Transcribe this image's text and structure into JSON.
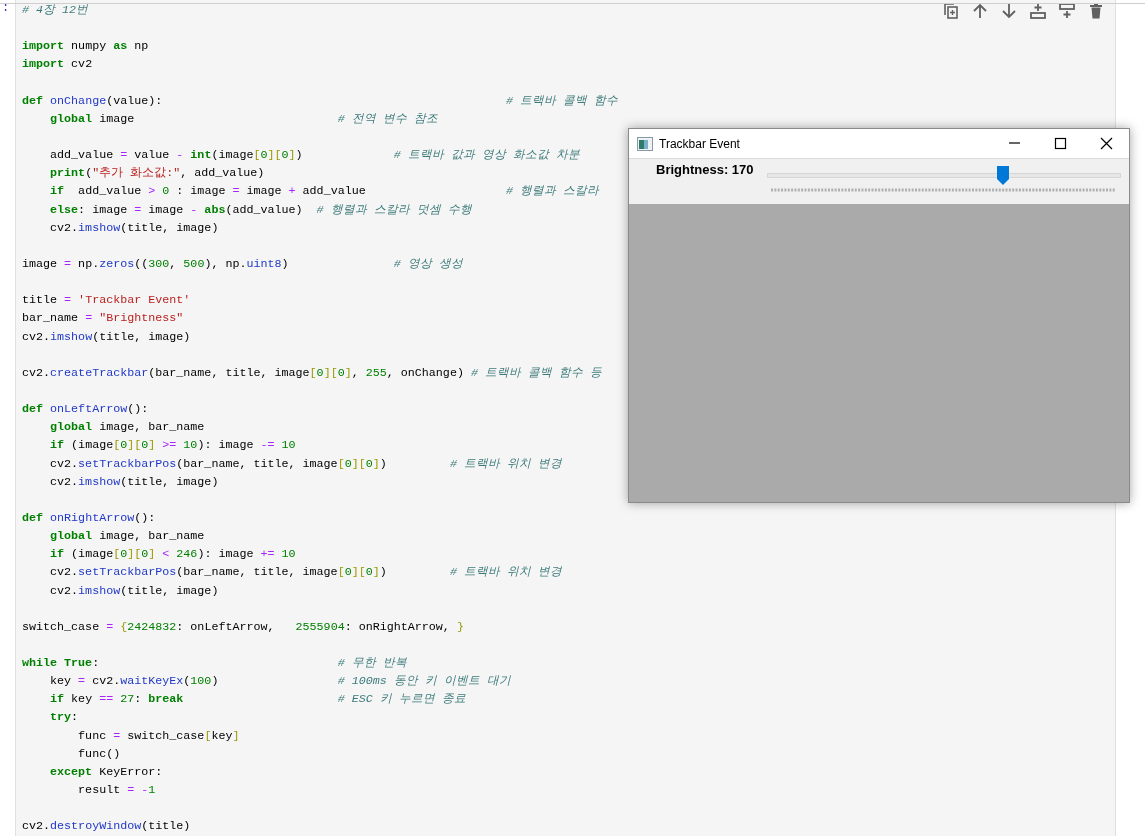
{
  "cell": {
    "prompt": ":",
    "blocks": [
      [
        [
          {
            "kind": "cm",
            "text": "# 4장 12번"
          }
        ]
      ],
      [
        [
          {
            "kind": "kw",
            "text": "import"
          },
          {
            "kind": "tx",
            "text": " numpy "
          },
          {
            "kind": "kw",
            "text": "as"
          },
          {
            "kind": "tx",
            "text": " np"
          }
        ],
        [
          {
            "kind": "kw",
            "text": "import"
          },
          {
            "kind": "tx",
            "text": " cv2"
          }
        ]
      ],
      [
        [
          {
            "kind": "kw",
            "text": "def "
          },
          {
            "kind": "call",
            "text": "onChange"
          },
          {
            "kind": "tx",
            "text": "(value):                                                 "
          },
          {
            "kind": "cm",
            "text": "# 트랙바 콜백 함수"
          }
        ],
        [
          {
            "kind": "kw",
            "text": "    global"
          },
          {
            "kind": "tx",
            "text": " image                             "
          },
          {
            "kind": "cm",
            "text": "# 전역 변수 참조"
          }
        ]
      ],
      [
        [
          {
            "kind": "tx",
            "text": "    add_value "
          },
          {
            "kind": "op",
            "text": "="
          },
          {
            "kind": "tx",
            "text": " value "
          },
          {
            "kind": "op",
            "text": "-"
          },
          {
            "kind": "kw",
            "text": " int"
          },
          {
            "kind": "tx",
            "text": "(image"
          },
          {
            "kind": "br",
            "text": "["
          },
          {
            "kind": "num",
            "text": "0"
          },
          {
            "kind": "br",
            "text": "]["
          },
          {
            "kind": "num",
            "text": "0"
          },
          {
            "kind": "br",
            "text": "]"
          },
          {
            "kind": "tx",
            "text": ")             "
          },
          {
            "kind": "cm",
            "text": "# 트랙바 값과 영상 화소값 차분"
          }
        ],
        [
          {
            "kind": "kw",
            "text": "    print"
          },
          {
            "kind": "tx",
            "text": "("
          },
          {
            "kind": "str",
            "text": "\"추가 화소값:\""
          },
          {
            "kind": "tx",
            "text": ", add_value)"
          }
        ],
        [
          {
            "kind": "kw",
            "text": "    if"
          },
          {
            "kind": "tx",
            "text": "  add_value "
          },
          {
            "kind": "op",
            "text": ">"
          },
          {
            "kind": "num",
            "text": " 0"
          },
          {
            "kind": "tx",
            "text": " : image "
          },
          {
            "kind": "op",
            "text": "="
          },
          {
            "kind": "tx",
            "text": " image "
          },
          {
            "kind": "op",
            "text": "+"
          },
          {
            "kind": "tx",
            "text": " add_value                    "
          },
          {
            "kind": "cm",
            "text": "# 행렬과 스칼라"
          }
        ],
        [
          {
            "kind": "kw",
            "text": "    else"
          },
          {
            "kind": "tx",
            "text": ": image "
          },
          {
            "kind": "op",
            "text": "="
          },
          {
            "kind": "tx",
            "text": " image "
          },
          {
            "kind": "op",
            "text": "-"
          },
          {
            "kind": "kw",
            "text": " abs"
          },
          {
            "kind": "tx",
            "text": "(add_value)  "
          },
          {
            "kind": "cm",
            "text": "# 행렬과 스칼라 덧셈 수행"
          }
        ],
        [
          {
            "kind": "tx",
            "text": "    cv2."
          },
          {
            "kind": "call",
            "text": "imshow"
          },
          {
            "kind": "tx",
            "text": "(title, image)"
          }
        ]
      ],
      [
        [
          {
            "kind": "tx",
            "text": "image "
          },
          {
            "kind": "op",
            "text": "="
          },
          {
            "kind": "tx",
            "text": " np."
          },
          {
            "kind": "call",
            "text": "zeros"
          },
          {
            "kind": "tx",
            "text": "(("
          },
          {
            "kind": "num",
            "text": "300"
          },
          {
            "kind": "tx",
            "text": ", "
          },
          {
            "kind": "num",
            "text": "500"
          },
          {
            "kind": "tx",
            "text": "), np."
          },
          {
            "kind": "call",
            "text": "uint8"
          },
          {
            "kind": "tx",
            "text": ")               "
          },
          {
            "kind": "cm",
            "text": "# 영상 생성"
          }
        ]
      ],
      [
        [
          {
            "kind": "tx",
            "text": "title "
          },
          {
            "kind": "op",
            "text": "="
          },
          {
            "kind": "str",
            "text": " 'Trackbar Event'"
          }
        ],
        [
          {
            "kind": "tx",
            "text": "bar_name "
          },
          {
            "kind": "op",
            "text": "="
          },
          {
            "kind": "str",
            "text": " \"Brightness\""
          }
        ],
        [
          {
            "kind": "tx",
            "text": "cv2."
          },
          {
            "kind": "call",
            "text": "imshow"
          },
          {
            "kind": "tx",
            "text": "(title, image)"
          }
        ]
      ],
      [
        [
          {
            "kind": "tx",
            "text": "cv2."
          },
          {
            "kind": "call",
            "text": "createTrackbar"
          },
          {
            "kind": "tx",
            "text": "(bar_name, title, image"
          },
          {
            "kind": "br",
            "text": "["
          },
          {
            "kind": "num",
            "text": "0"
          },
          {
            "kind": "br",
            "text": "]["
          },
          {
            "kind": "num",
            "text": "0"
          },
          {
            "kind": "br",
            "text": "]"
          },
          {
            "kind": "tx",
            "text": ", "
          },
          {
            "kind": "num",
            "text": "255"
          },
          {
            "kind": "tx",
            "text": ", onChange) "
          },
          {
            "kind": "cm",
            "text": "# 트랙바 콜백 함수 등"
          }
        ]
      ],
      [
        [
          {
            "kind": "kw",
            "text": "def "
          },
          {
            "kind": "call",
            "text": "onLeftArrow"
          },
          {
            "kind": "tx",
            "text": "():"
          }
        ],
        [
          {
            "kind": "kw",
            "text": "    global"
          },
          {
            "kind": "tx",
            "text": " image, bar_name"
          }
        ],
        [
          {
            "kind": "kw",
            "text": "    if"
          },
          {
            "kind": "tx",
            "text": " (image"
          },
          {
            "kind": "br",
            "text": "["
          },
          {
            "kind": "num",
            "text": "0"
          },
          {
            "kind": "br",
            "text": "]["
          },
          {
            "kind": "num",
            "text": "0"
          },
          {
            "kind": "br",
            "text": "]"
          },
          {
            "kind": "op",
            "text": " >="
          },
          {
            "kind": "num",
            "text": " 10"
          },
          {
            "kind": "tx",
            "text": "): image "
          },
          {
            "kind": "op",
            "text": "-="
          },
          {
            "kind": "num",
            "text": " 10"
          }
        ],
        [
          {
            "kind": "tx",
            "text": "    cv2."
          },
          {
            "kind": "call",
            "text": "setTrackbarPos"
          },
          {
            "kind": "tx",
            "text": "(bar_name, title, image"
          },
          {
            "kind": "br",
            "text": "["
          },
          {
            "kind": "num",
            "text": "0"
          },
          {
            "kind": "br",
            "text": "]["
          },
          {
            "kind": "num",
            "text": "0"
          },
          {
            "kind": "br",
            "text": "]"
          },
          {
            "kind": "tx",
            "text": ")         "
          },
          {
            "kind": "cm",
            "text": "# 트랙바 위치 변경"
          }
        ],
        [
          {
            "kind": "tx",
            "text": "    cv2."
          },
          {
            "kind": "call",
            "text": "imshow"
          },
          {
            "kind": "tx",
            "text": "(title, image)"
          }
        ]
      ],
      [
        [
          {
            "kind": "kw",
            "text": "def "
          },
          {
            "kind": "call",
            "text": "onRightArrow"
          },
          {
            "kind": "tx",
            "text": "():"
          }
        ],
        [
          {
            "kind": "kw",
            "text": "    global"
          },
          {
            "kind": "tx",
            "text": " image, bar_name"
          }
        ],
        [
          {
            "kind": "kw",
            "text": "    if"
          },
          {
            "kind": "tx",
            "text": " (image"
          },
          {
            "kind": "br",
            "text": "["
          },
          {
            "kind": "num",
            "text": "0"
          },
          {
            "kind": "br",
            "text": "]["
          },
          {
            "kind": "num",
            "text": "0"
          },
          {
            "kind": "br",
            "text": "]"
          },
          {
            "kind": "op",
            "text": " <"
          },
          {
            "kind": "num",
            "text": " 246"
          },
          {
            "kind": "tx",
            "text": "): image "
          },
          {
            "kind": "op",
            "text": "+="
          },
          {
            "kind": "num",
            "text": " 10"
          }
        ],
        [
          {
            "kind": "tx",
            "text": "    cv2."
          },
          {
            "kind": "call",
            "text": "setTrackbarPos"
          },
          {
            "kind": "tx",
            "text": "(bar_name, title, image"
          },
          {
            "kind": "br",
            "text": "["
          },
          {
            "kind": "num",
            "text": "0"
          },
          {
            "kind": "br",
            "text": "]["
          },
          {
            "kind": "num",
            "text": "0"
          },
          {
            "kind": "br",
            "text": "]"
          },
          {
            "kind": "tx",
            "text": ")         "
          },
          {
            "kind": "cm",
            "text": "# 트랙바 위치 변경"
          }
        ],
        [
          {
            "kind": "tx",
            "text": "    cv2."
          },
          {
            "kind": "call",
            "text": "imshow"
          },
          {
            "kind": "tx",
            "text": "(title, image)"
          }
        ]
      ],
      [
        [
          {
            "kind": "tx",
            "text": "switch_case "
          },
          {
            "kind": "op",
            "text": "="
          },
          {
            "kind": "br",
            "text": " {"
          },
          {
            "kind": "num",
            "text": "2424832"
          },
          {
            "kind": "tx",
            "text": ": onLeftArrow,   "
          },
          {
            "kind": "num",
            "text": "2555904"
          },
          {
            "kind": "tx",
            "text": ": onRightArrow, "
          },
          {
            "kind": "br",
            "text": "}"
          }
        ]
      ],
      [
        [
          {
            "kind": "kw",
            "text": "while True"
          },
          {
            "kind": "tx",
            "text": ":                                  "
          },
          {
            "kind": "cm",
            "text": "# 무한 반복"
          }
        ],
        [
          {
            "kind": "tx",
            "text": "    key "
          },
          {
            "kind": "op",
            "text": "="
          },
          {
            "kind": "tx",
            "text": " cv2."
          },
          {
            "kind": "call",
            "text": "waitKeyEx"
          },
          {
            "kind": "tx",
            "text": "("
          },
          {
            "kind": "num",
            "text": "100"
          },
          {
            "kind": "tx",
            "text": ")                 "
          },
          {
            "kind": "cm",
            "text": "# 100ms 동안 키 이벤트 대기"
          }
        ],
        [
          {
            "kind": "kw",
            "text": "    if"
          },
          {
            "kind": "tx",
            "text": " key "
          },
          {
            "kind": "op",
            "text": "=="
          },
          {
            "kind": "num",
            "text": " 27"
          },
          {
            "kind": "tx",
            "text": ": "
          },
          {
            "kind": "kw",
            "text": "break                      "
          },
          {
            "kind": "cm",
            "text": "# ESC 키 누르면 종료"
          }
        ],
        [
          {
            "kind": "kw",
            "text": "    try"
          },
          {
            "kind": "tx",
            "text": ":"
          }
        ],
        [
          {
            "kind": "tx",
            "text": "        func "
          },
          {
            "kind": "op",
            "text": "="
          },
          {
            "kind": "tx",
            "text": " switch_case"
          },
          {
            "kind": "br",
            "text": "["
          },
          {
            "kind": "tx",
            "text": "key"
          },
          {
            "kind": "br",
            "text": "]"
          }
        ],
        [
          {
            "kind": "tx",
            "text": "        func()"
          }
        ],
        [
          {
            "kind": "kw",
            "text": "    except"
          },
          {
            "kind": "tx",
            "text": " KeyError:"
          }
        ],
        [
          {
            "kind": "tx",
            "text": "        result "
          },
          {
            "kind": "op",
            "text": "= -"
          },
          {
            "kind": "num",
            "text": "1"
          }
        ]
      ],
      [
        [
          {
            "kind": "tx",
            "text": "cv2."
          },
          {
            "kind": "call",
            "text": "destroyWindow"
          },
          {
            "kind": "tx",
            "text": "(title)"
          }
        ]
      ]
    ]
  },
  "window": {
    "title": "Trackbar Event",
    "trackbar": {
      "label": "Brightness: 170",
      "level": 0.667
    }
  }
}
